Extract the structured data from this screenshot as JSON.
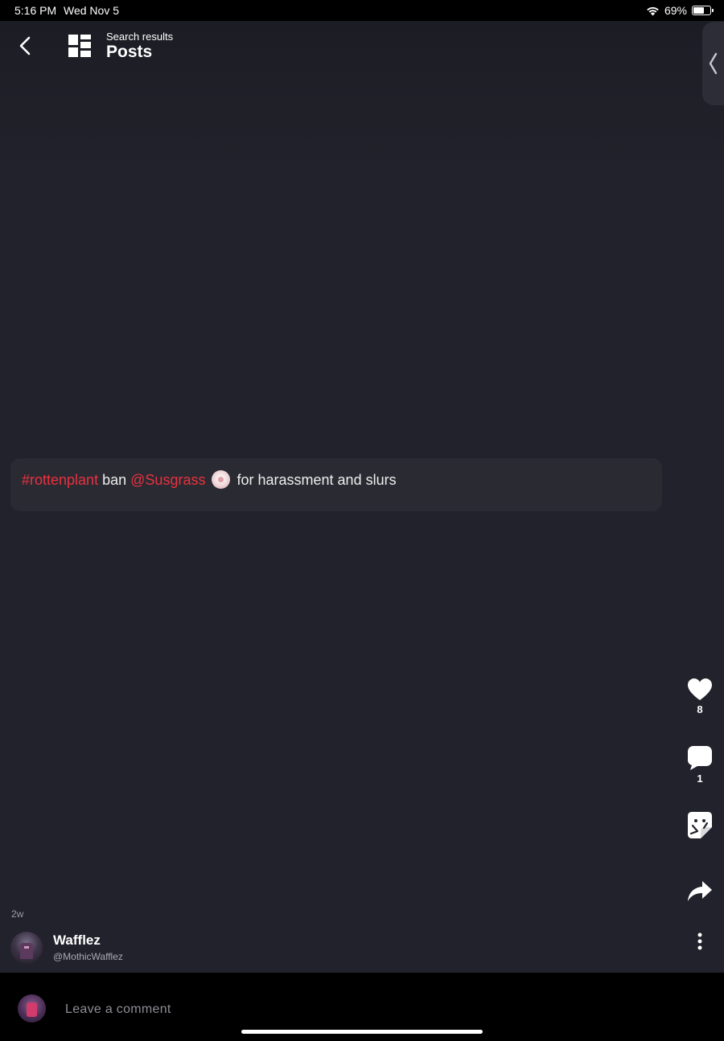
{
  "status_bar": {
    "time": "5:16 PM",
    "date": "Wed Nov 5",
    "battery_text": "69%",
    "battery_level": 0.69,
    "wifi_icon": "wifi-icon",
    "battery_icon": "battery-icon"
  },
  "header": {
    "subtitle": "Search results",
    "title": "Posts",
    "back_icon": "chevron-left-icon",
    "layout_icon": "layout-grid-icon",
    "side_tab_icon": "chevron-left-icon"
  },
  "post": {
    "hashtag": "#rottenplant",
    "text_1": "ban",
    "mention": "@Susgrass",
    "text_2": "for harassment and slurs"
  },
  "actions": {
    "like_count": "8",
    "comment_count": "1",
    "like_icon": "heart-icon",
    "comment_icon": "speech-bubble-icon",
    "sticker_icon": "sticker-icon",
    "share_icon": "share-arrow-icon",
    "more_icon": "more-vertical-icon"
  },
  "author": {
    "time_ago": "2w",
    "name": "Wafflez",
    "handle": "@MothicWafflez"
  },
  "comment": {
    "placeholder": "Leave a comment"
  },
  "colors": {
    "accent": "#e8323e",
    "background": "#22222c",
    "card": "#2a2a33"
  }
}
